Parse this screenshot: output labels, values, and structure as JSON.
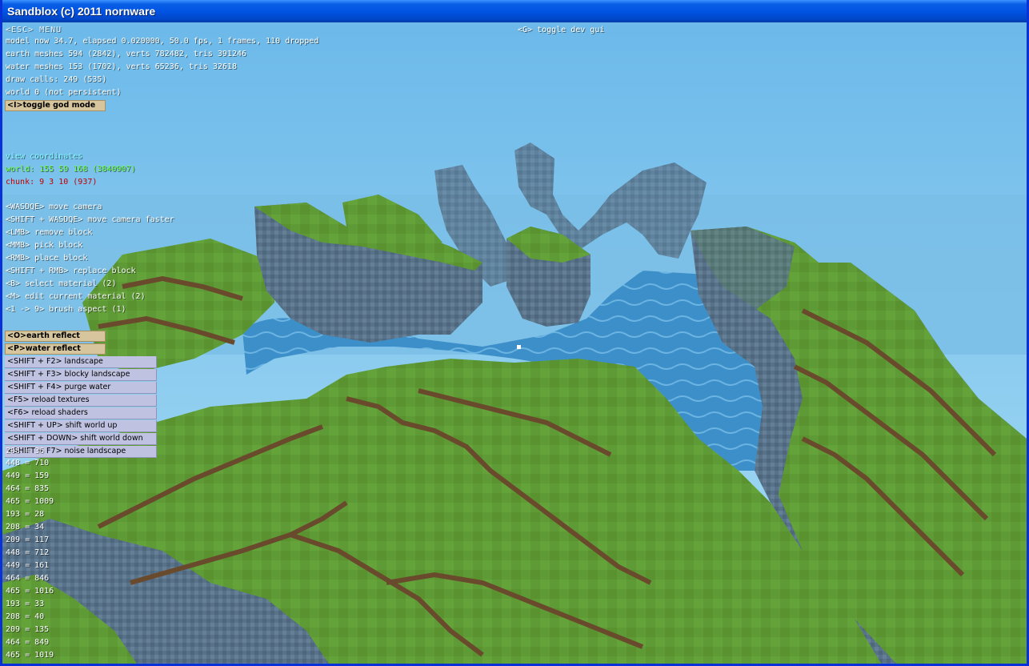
{
  "window": {
    "title": "Sandblox (c) 2011 nornware"
  },
  "hud": {
    "menu_label": "<ESC> MENU",
    "dev_gui_hint": "<G> toggle dev gui",
    "stats": [
      "model now 34.7, elapsed 0.020000, 50.0 fps, 1 frames, 110 dropped",
      "earth meshes 594 (2842), verts 782482, tris 391246",
      "water meshes 153 (1702), verts 65236, tris 32618",
      "draw calls: 249 (535)",
      "world 0 (not persistent)"
    ],
    "god_mode_button": "<I>toggle god mode",
    "view_coordinates_label": "view coordinates",
    "world_coords": "world: 155 59 168 (3840907)",
    "chunk_coords": "chunk: 9 3 10 (937)",
    "controls": [
      "<WASDQE> move camera",
      "<SHIFT + WASDQE> move camera faster",
      "<LMB> remove block",
      "<MMB> pick block",
      "<RMB> place block",
      "<SHIFT + RMB> replace block",
      "<B> select material (2)",
      "<M> edit current material (2)",
      "<1 -> 9> brush aspect (1)"
    ],
    "toggle_buttons": [
      "<O>earth reflect",
      "<P>water reflect"
    ],
    "dev_buttons": [
      "<SHIFT + F2> landscape",
      "<SHIFT + F3> blocky landscape",
      "<SHIFT + F4> purge water",
      "<F5> reload textures",
      "<F6> reload shaders",
      "<SHIFT + UP> shift world up",
      "<SHIFT + DOWN> shift world down",
      "<SHIFT + F7> noise landscape"
    ],
    "overlap_text": "208 = 36",
    "debug_values": [
      "448 = 710",
      "449 = 159",
      "464 = 835",
      "465 = 1009",
      "193 = 28",
      "208 = 34",
      "209 = 117",
      "448 = 712",
      "449 = 161",
      "464 = 846",
      "465 = 1016",
      "193 = 33",
      "208 = 40",
      "209 = 135",
      "464 = 849",
      "465 = 1019"
    ]
  },
  "colors": {
    "titlebar": "#0054e3",
    "sky": "#8fd0f2",
    "grass": "#5e9a36",
    "water": "#3d8fc9",
    "tan_button": "#d6c59d",
    "lavender_button": "#bfc3e1",
    "chunk_text": "#c30000",
    "world_text": "#6bff3a",
    "view_text": "#7ff8ff"
  }
}
